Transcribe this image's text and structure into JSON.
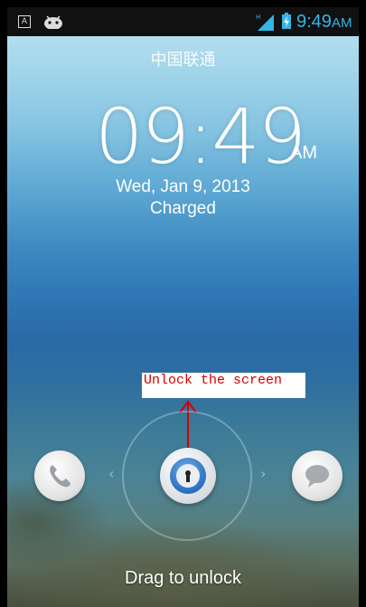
{
  "status_bar": {
    "input_indicator": "A",
    "time": "9:49",
    "ampm": "AM",
    "icons": [
      "keyboard-a-icon",
      "android-icon",
      "signal-h-icon",
      "battery-charging-icon"
    ],
    "accent_color": "#33b5e5"
  },
  "lockscreen": {
    "carrier": "中国联通",
    "clock": "09:49",
    "clock_ampm": "AM",
    "date": "Wed, Jan 9, 2013",
    "battery_status": "Charged",
    "hint": "Drag to unlock",
    "targets": [
      "phone-icon",
      "unlock-handle-icon",
      "message-icon"
    ]
  },
  "annotation": {
    "text": "Unlock the screen",
    "color": "#d40000"
  }
}
